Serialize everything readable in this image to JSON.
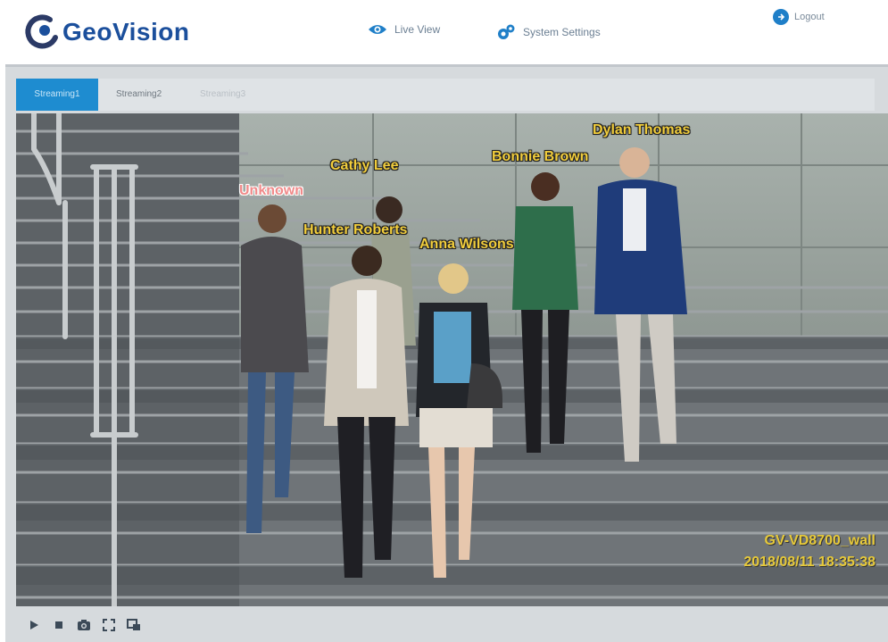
{
  "header": {
    "logo_text": "GeoVision",
    "nav": [
      {
        "label": "Live View",
        "icon": "eye-icon"
      },
      {
        "label": "System Settings",
        "icon": "gear-icon"
      }
    ],
    "logout_label": "Logout"
  },
  "tabs": [
    {
      "label": "Streaming1",
      "active": true
    },
    {
      "label": "Streaming2",
      "active": false
    },
    {
      "label": "Streaming3",
      "active": false
    }
  ],
  "video": {
    "faces": [
      {
        "name": "Unknown",
        "status": "unknown"
      },
      {
        "name": "Cathy  Lee",
        "status": "known"
      },
      {
        "name": "Hunter Roberts",
        "status": "known"
      },
      {
        "name": "Anna Wilsons",
        "status": "known"
      },
      {
        "name": "Bonnie Brown",
        "status": "known"
      },
      {
        "name": "Dylan Thomas",
        "status": "known"
      }
    ],
    "camera_name": "GV-VD8700_wall",
    "timestamp": "2018/08/11  18:35:38"
  },
  "controls": [
    {
      "icon": "play-icon"
    },
    {
      "icon": "stop-icon"
    },
    {
      "icon": "camera-icon"
    },
    {
      "icon": "fullscreen-icon"
    },
    {
      "icon": "picture-in-picture-icon"
    }
  ],
  "colors": {
    "brand_blue": "#1b4f9c",
    "active_tab": "#1e8cd0",
    "known_label": "#f1cd3c",
    "unknown_label": "#f08a8a",
    "osd_text": "#e6c93a"
  }
}
